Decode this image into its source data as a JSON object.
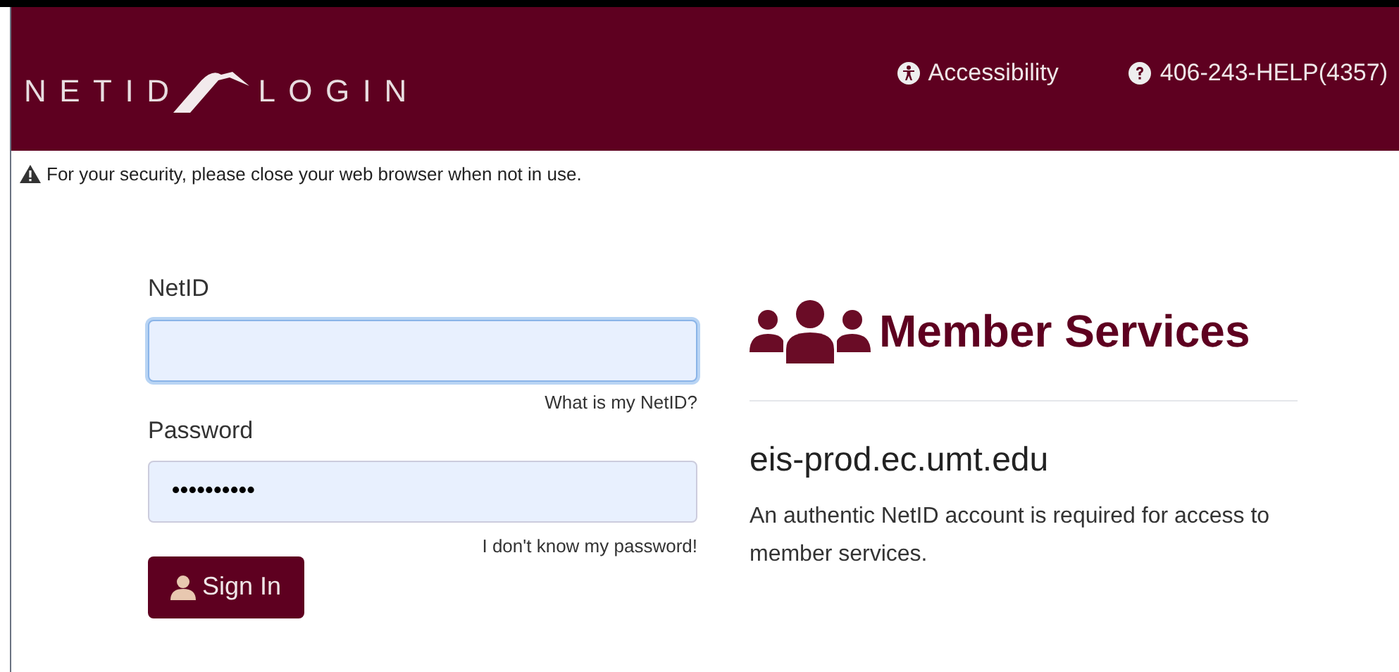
{
  "header": {
    "logo_left": "NETID",
    "logo_right": "LOGIN",
    "links": [
      {
        "kind": "accessibility",
        "label": "Accessibility"
      },
      {
        "kind": "help",
        "label": "406-243-HELP(4357)"
      }
    ]
  },
  "notice": "For your security, please close your web browser when not in use.",
  "form": {
    "netid_label": "NetID",
    "netid_focused": true,
    "netid_help": "What is my NetID?",
    "password_label": "Password",
    "password_value": "••••••••••",
    "password_help": "I don't know my password!",
    "submit": "Sign In"
  },
  "info": {
    "title": "Member Services",
    "host": "eis-prod.ec.umt.edu",
    "description": "An authentic NetID account is required for access to member services."
  }
}
